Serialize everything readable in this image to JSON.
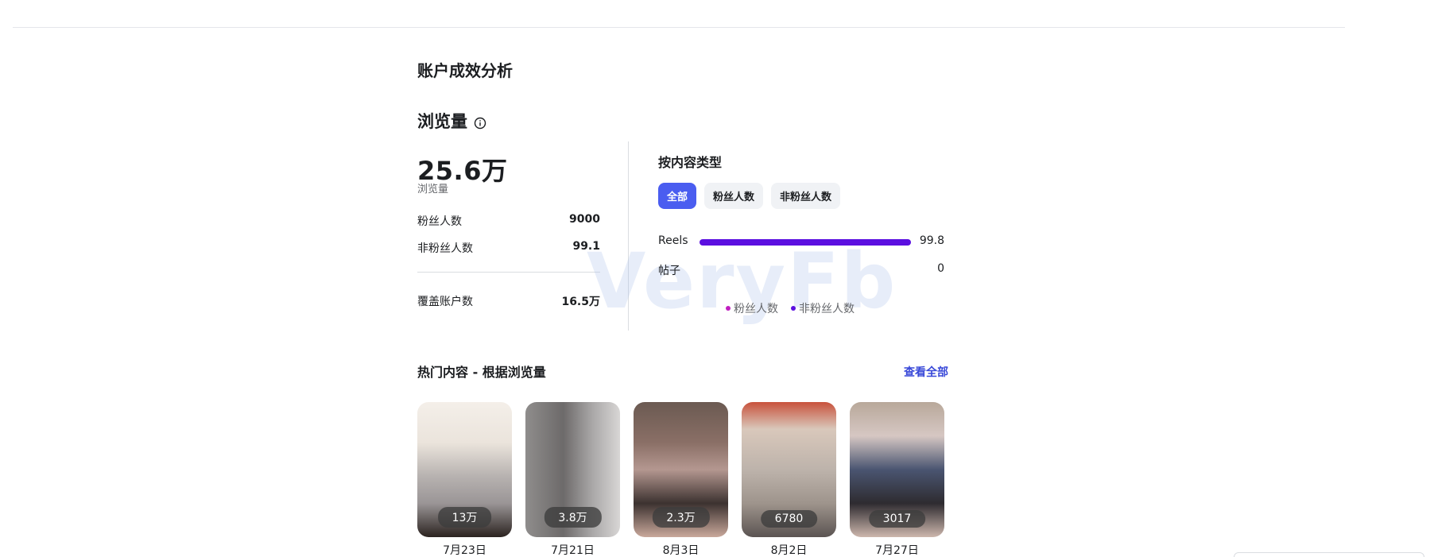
{
  "header": {
    "section_title": "账户成效分析",
    "views_title": "浏览量"
  },
  "summary": {
    "total_views": "25.6万",
    "total_caption": "浏览量",
    "rows": [
      {
        "label": "粉丝人数",
        "value": "9000"
      },
      {
        "label": "非粉丝人数",
        "value": "99.1"
      }
    ],
    "reach": {
      "label": "覆盖账户数",
      "value": "16.5万"
    }
  },
  "by_content_type": {
    "title": "按内容类型",
    "filters": [
      {
        "label": "全部",
        "active": true
      },
      {
        "label": "粉丝人数",
        "active": false
      },
      {
        "label": "非粉丝人数",
        "active": false
      }
    ],
    "bars": [
      {
        "label": "Reels",
        "value": "99.8",
        "fill_percent": 100
      },
      {
        "label": "帖子",
        "value": "0",
        "fill_percent": 0
      }
    ],
    "legend": [
      {
        "label": "粉丝人数",
        "color": "#c01ec0"
      },
      {
        "label": "非粉丝人数",
        "color": "#5b0fe0"
      }
    ],
    "bar_color": "#5b0fe0"
  },
  "watermark": "VeryFb",
  "top_content": {
    "title": "热门内容 - 根据浏览量",
    "see_all": "查看全部",
    "items": [
      {
        "views": "13万",
        "date": "7月23日"
      },
      {
        "views": "3.8万",
        "date": "7月21日"
      },
      {
        "views": "2.3万",
        "date": "8月3日"
      },
      {
        "views": "6780",
        "date": "8月2日"
      },
      {
        "views": "3017",
        "date": "7月27日"
      }
    ]
  },
  "colors": {
    "accent": "#4a5df0",
    "link": "#3848d8"
  }
}
